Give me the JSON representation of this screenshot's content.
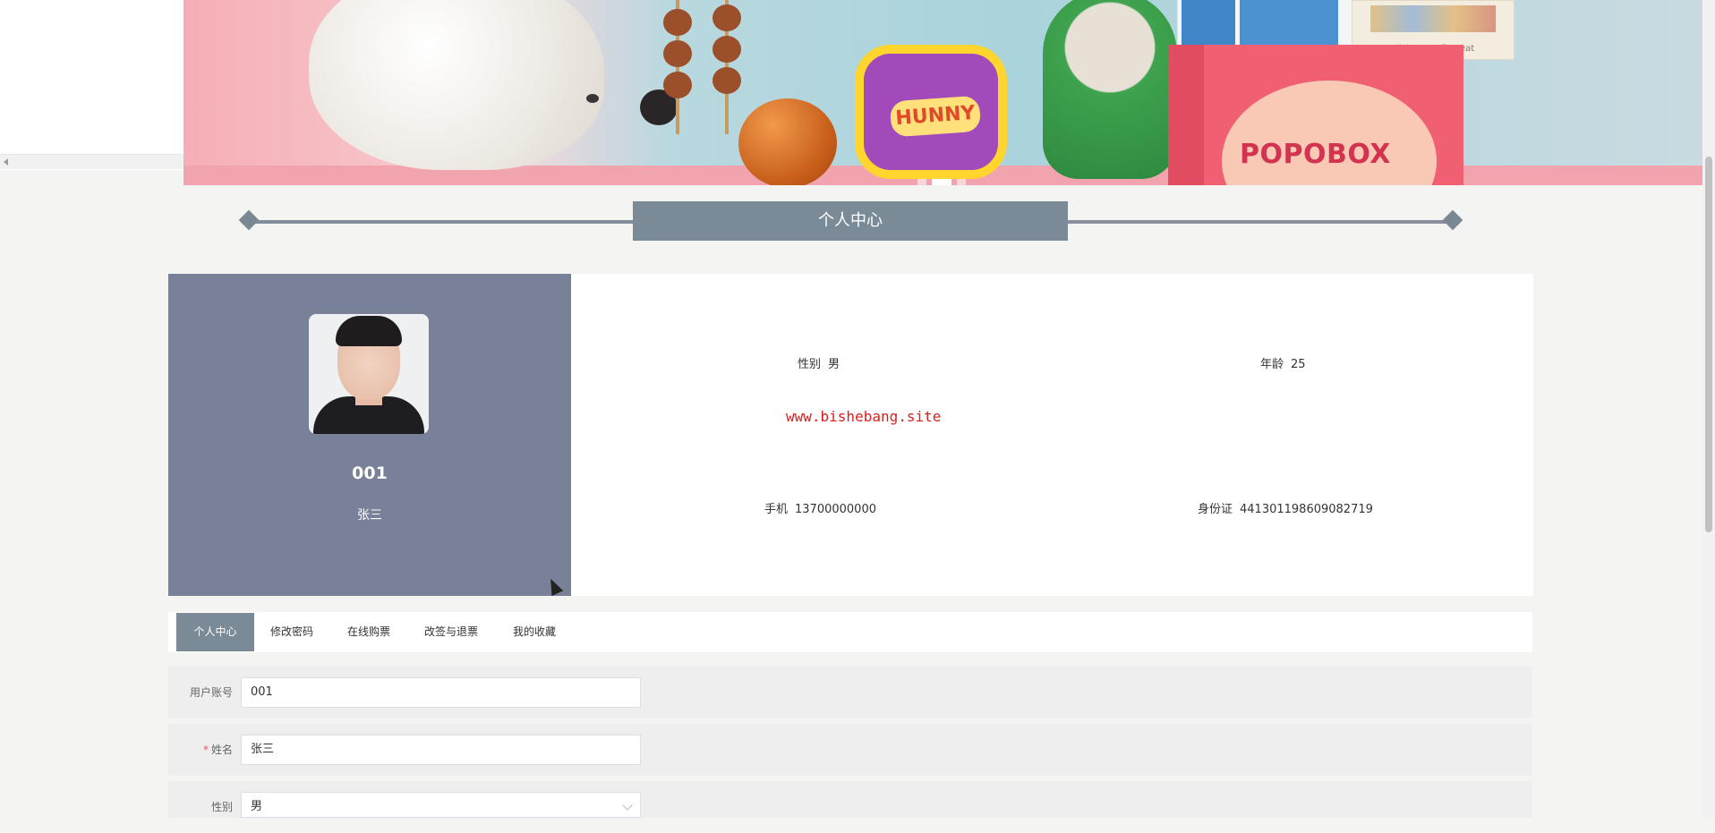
{
  "banner": {
    "honey_text": "HUNNY",
    "box_text": "POPOBOX",
    "card_caption": "trick or outfit treat",
    "slide_count": 3,
    "active_slide": 2
  },
  "section": {
    "title": "个人中心"
  },
  "profile": {
    "account": "001",
    "name": "张三",
    "fields": [
      {
        "label": "性别",
        "value": "男"
      },
      {
        "label": "年龄",
        "value": "25"
      },
      {
        "label": "手机",
        "value": "13700000000"
      },
      {
        "label": "身份证",
        "value": "441301198609082719"
      }
    ],
    "watermark": "www.bishebang.site"
  },
  "tabs": [
    {
      "label": "个人中心",
      "active": true
    },
    {
      "label": "修改密码",
      "active": false
    },
    {
      "label": "在线购票",
      "active": false
    },
    {
      "label": "改签与退票",
      "active": false
    },
    {
      "label": "我的收藏",
      "active": false
    }
  ],
  "form": {
    "rows": [
      {
        "label": "用户账号",
        "required": false,
        "value": "001",
        "type": "text"
      },
      {
        "label": "姓名",
        "required": true,
        "value": "张三",
        "type": "text"
      },
      {
        "label": "性别",
        "required": false,
        "value": "男",
        "type": "select"
      }
    ],
    "required_mark": "*"
  },
  "colors": {
    "accent": "#7a8a97",
    "profile_panel": "#788198",
    "watermark": "#d71f1f",
    "page_bg": "#f4f4f3"
  }
}
